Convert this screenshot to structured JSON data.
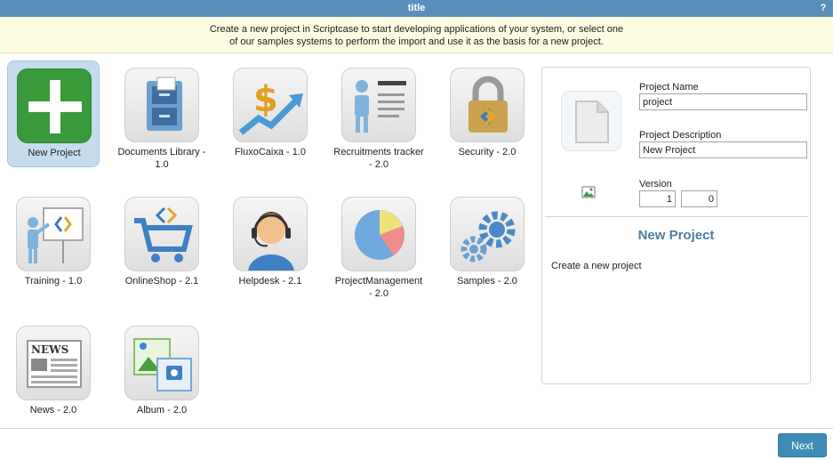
{
  "window": {
    "title": "title",
    "help_label": "?"
  },
  "banner": {
    "line1": "Create a new project in Scriptcase to start developing applications of your system, or select one",
    "line2": "of our samples systems to perform the import and use it as the basis for a new project."
  },
  "gallery": {
    "tiles": [
      {
        "label": "New Project",
        "icon": "plus-icon",
        "selected": true
      },
      {
        "label": "Documents Library - 1.0",
        "icon": "file-cabinet-icon"
      },
      {
        "label": "FluxoCaixa - 1.0",
        "icon": "dollar-growth-icon"
      },
      {
        "label": "Recruitments tracker - 2.0",
        "icon": "person-list-icon"
      },
      {
        "label": "Security - 2.0",
        "icon": "padlock-icon"
      },
      {
        "label": "Training - 1.0",
        "icon": "presentation-icon"
      },
      {
        "label": "OnlineShop - 2.1",
        "icon": "shopping-cart-icon"
      },
      {
        "label": "Helpdesk - 2.1",
        "icon": "headset-agent-icon"
      },
      {
        "label": "ProjectManagement - 2.0",
        "icon": "pie-chart-icon"
      },
      {
        "label": "Samples - 2.0",
        "icon": "gears-icon"
      },
      {
        "label": "News - 2.0",
        "icon": "newspaper-icon"
      },
      {
        "label": "Album - 2.0",
        "icon": "photo-album-icon"
      }
    ]
  },
  "details": {
    "project_name_label": "Project Name",
    "project_name_value": "project",
    "project_description_label": "Project Description",
    "project_description_value": "New Project",
    "version_label": "Version",
    "version_major": "1",
    "version_minor": "0",
    "preview_title": "New Project",
    "preview_description": "Create a new project"
  },
  "footer": {
    "next_label": "Next"
  },
  "colors": {
    "titlebar": "#5a8fbb",
    "banner": "#fdfbe0",
    "accent": "#4d7c9f",
    "button": "#3f8cb6",
    "selected_tile": "#c5dcef"
  }
}
